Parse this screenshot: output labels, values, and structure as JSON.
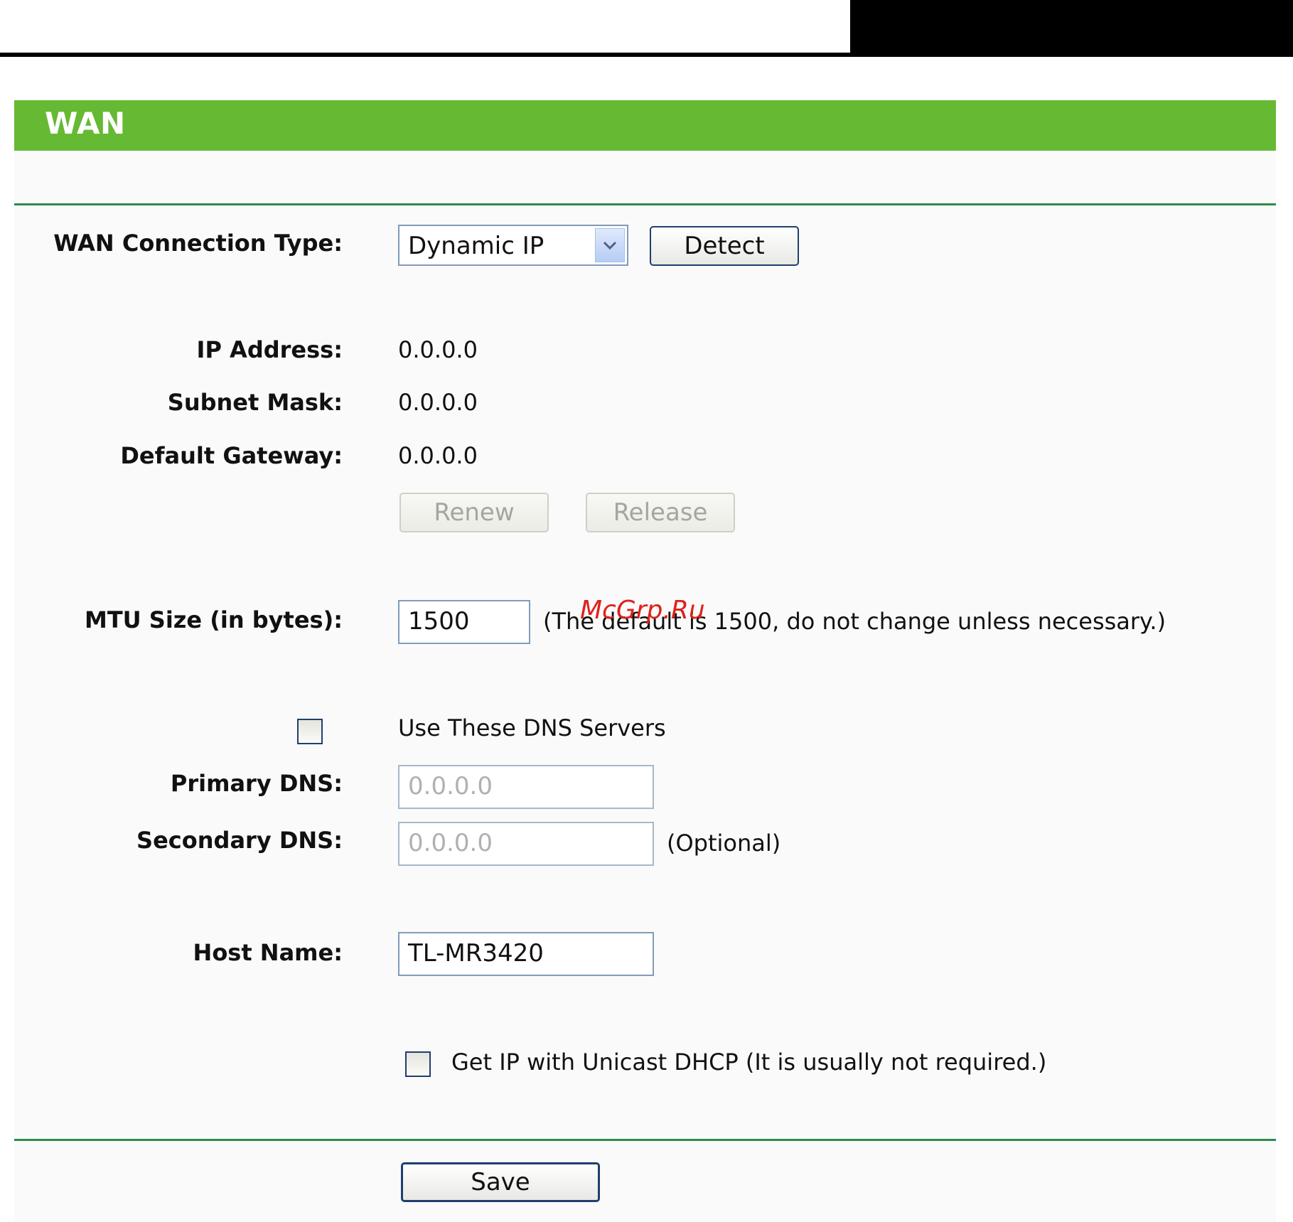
{
  "page": {
    "title": "WAN",
    "watermark": "McGrp.Ru"
  },
  "form": {
    "wan_connection_type": {
      "label": "WAN Connection Type:",
      "selected": "Dynamic IP",
      "detect_label": "Detect"
    },
    "ip_address": {
      "label": "IP Address:",
      "value": "0.0.0.0"
    },
    "subnet_mask": {
      "label": "Subnet Mask:",
      "value": "0.0.0.0"
    },
    "default_gateway": {
      "label": "Default Gateway:",
      "value": "0.0.0.0"
    },
    "renew_label": "Renew",
    "release_label": "Release",
    "mtu": {
      "label": "MTU Size (in bytes):",
      "value": "1500",
      "note": "(The default is 1500, do not change unless necessary.)"
    },
    "dns": {
      "use_label": "Use These DNS Servers",
      "use_checked": false,
      "primary_label": "Primary DNS:",
      "primary_value": "0.0.0.0",
      "secondary_label": "Secondary DNS:",
      "secondary_value": "0.0.0.0",
      "optional_note": "(Optional)"
    },
    "host_name": {
      "label": "Host Name:",
      "value": "TL-MR3420"
    },
    "unicast_dhcp": {
      "label": "Get IP with Unicast DHCP (It is usually not required.)",
      "checked": false
    },
    "save_label": "Save"
  },
  "colors": {
    "title_bar": "#66b933",
    "rule": "#2f8a4a"
  }
}
